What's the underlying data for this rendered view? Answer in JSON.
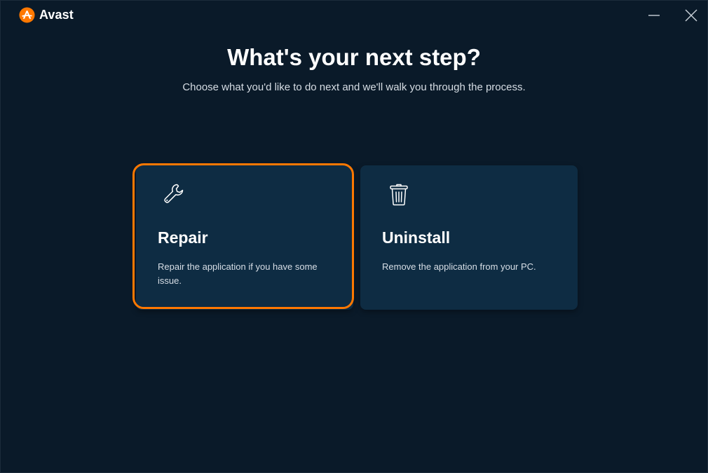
{
  "app": {
    "name": "Avast",
    "accent_color": "#ff7800",
    "background_color": "#0a1a29"
  },
  "window_controls": {
    "minimize_icon": "minimize-icon",
    "close_icon": "close-icon"
  },
  "main": {
    "title": "What's your next step?",
    "subtitle": "Choose what you'd like to do next and we'll walk you through the process."
  },
  "options": [
    {
      "id": "repair",
      "icon": "wrench-icon",
      "title": "Repair",
      "description": "Repair the application if you have some issue.",
      "focused": true
    },
    {
      "id": "uninstall",
      "icon": "trash-icon",
      "title": "Uninstall",
      "description": "Remove the application from your PC.",
      "focused": false
    }
  ]
}
